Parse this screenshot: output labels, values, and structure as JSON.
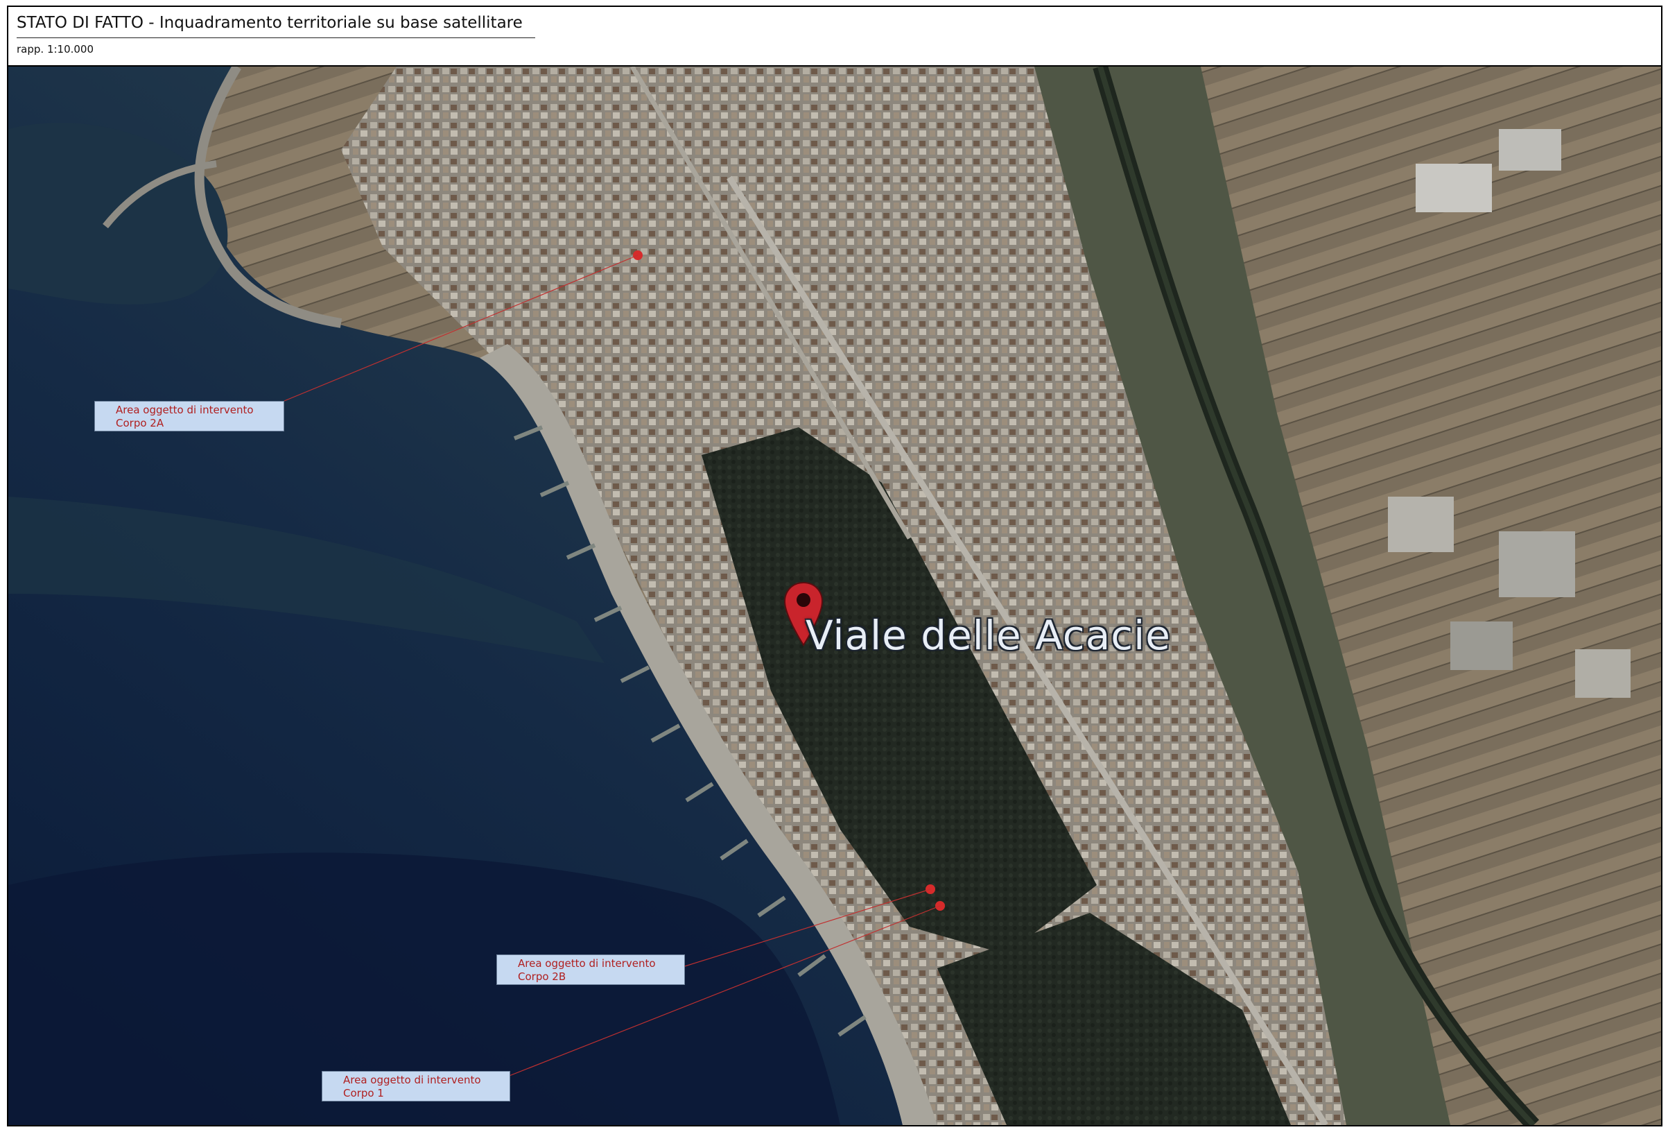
{
  "title_block": {
    "title": "STATO DI FATTO - Inquadramento territoriale su base satellitare",
    "scale": "rapp. 1:10.000"
  },
  "map": {
    "place_label": "Viale delle Acacie",
    "pin_icon": "map-pin-icon",
    "colors": {
      "sea_deep": "#0c1e3c",
      "sea_shallow": "#2c4756",
      "beach": "#a6a39a",
      "urban": "#8a857c",
      "forest": "#232a22",
      "farmland": "#7a6f5e",
      "marker": "#d62b2b",
      "callout_fill": "#c6d9f1",
      "callout_text": "#b02020"
    }
  },
  "callouts": [
    {
      "line1": "Area oggetto di intervento",
      "line2": "Corpo 2A"
    },
    {
      "line1": "Area oggetto di intervento",
      "line2": "Corpo 2B"
    },
    {
      "line1": "Area oggetto di intervento",
      "line2": "Corpo 1"
    }
  ]
}
